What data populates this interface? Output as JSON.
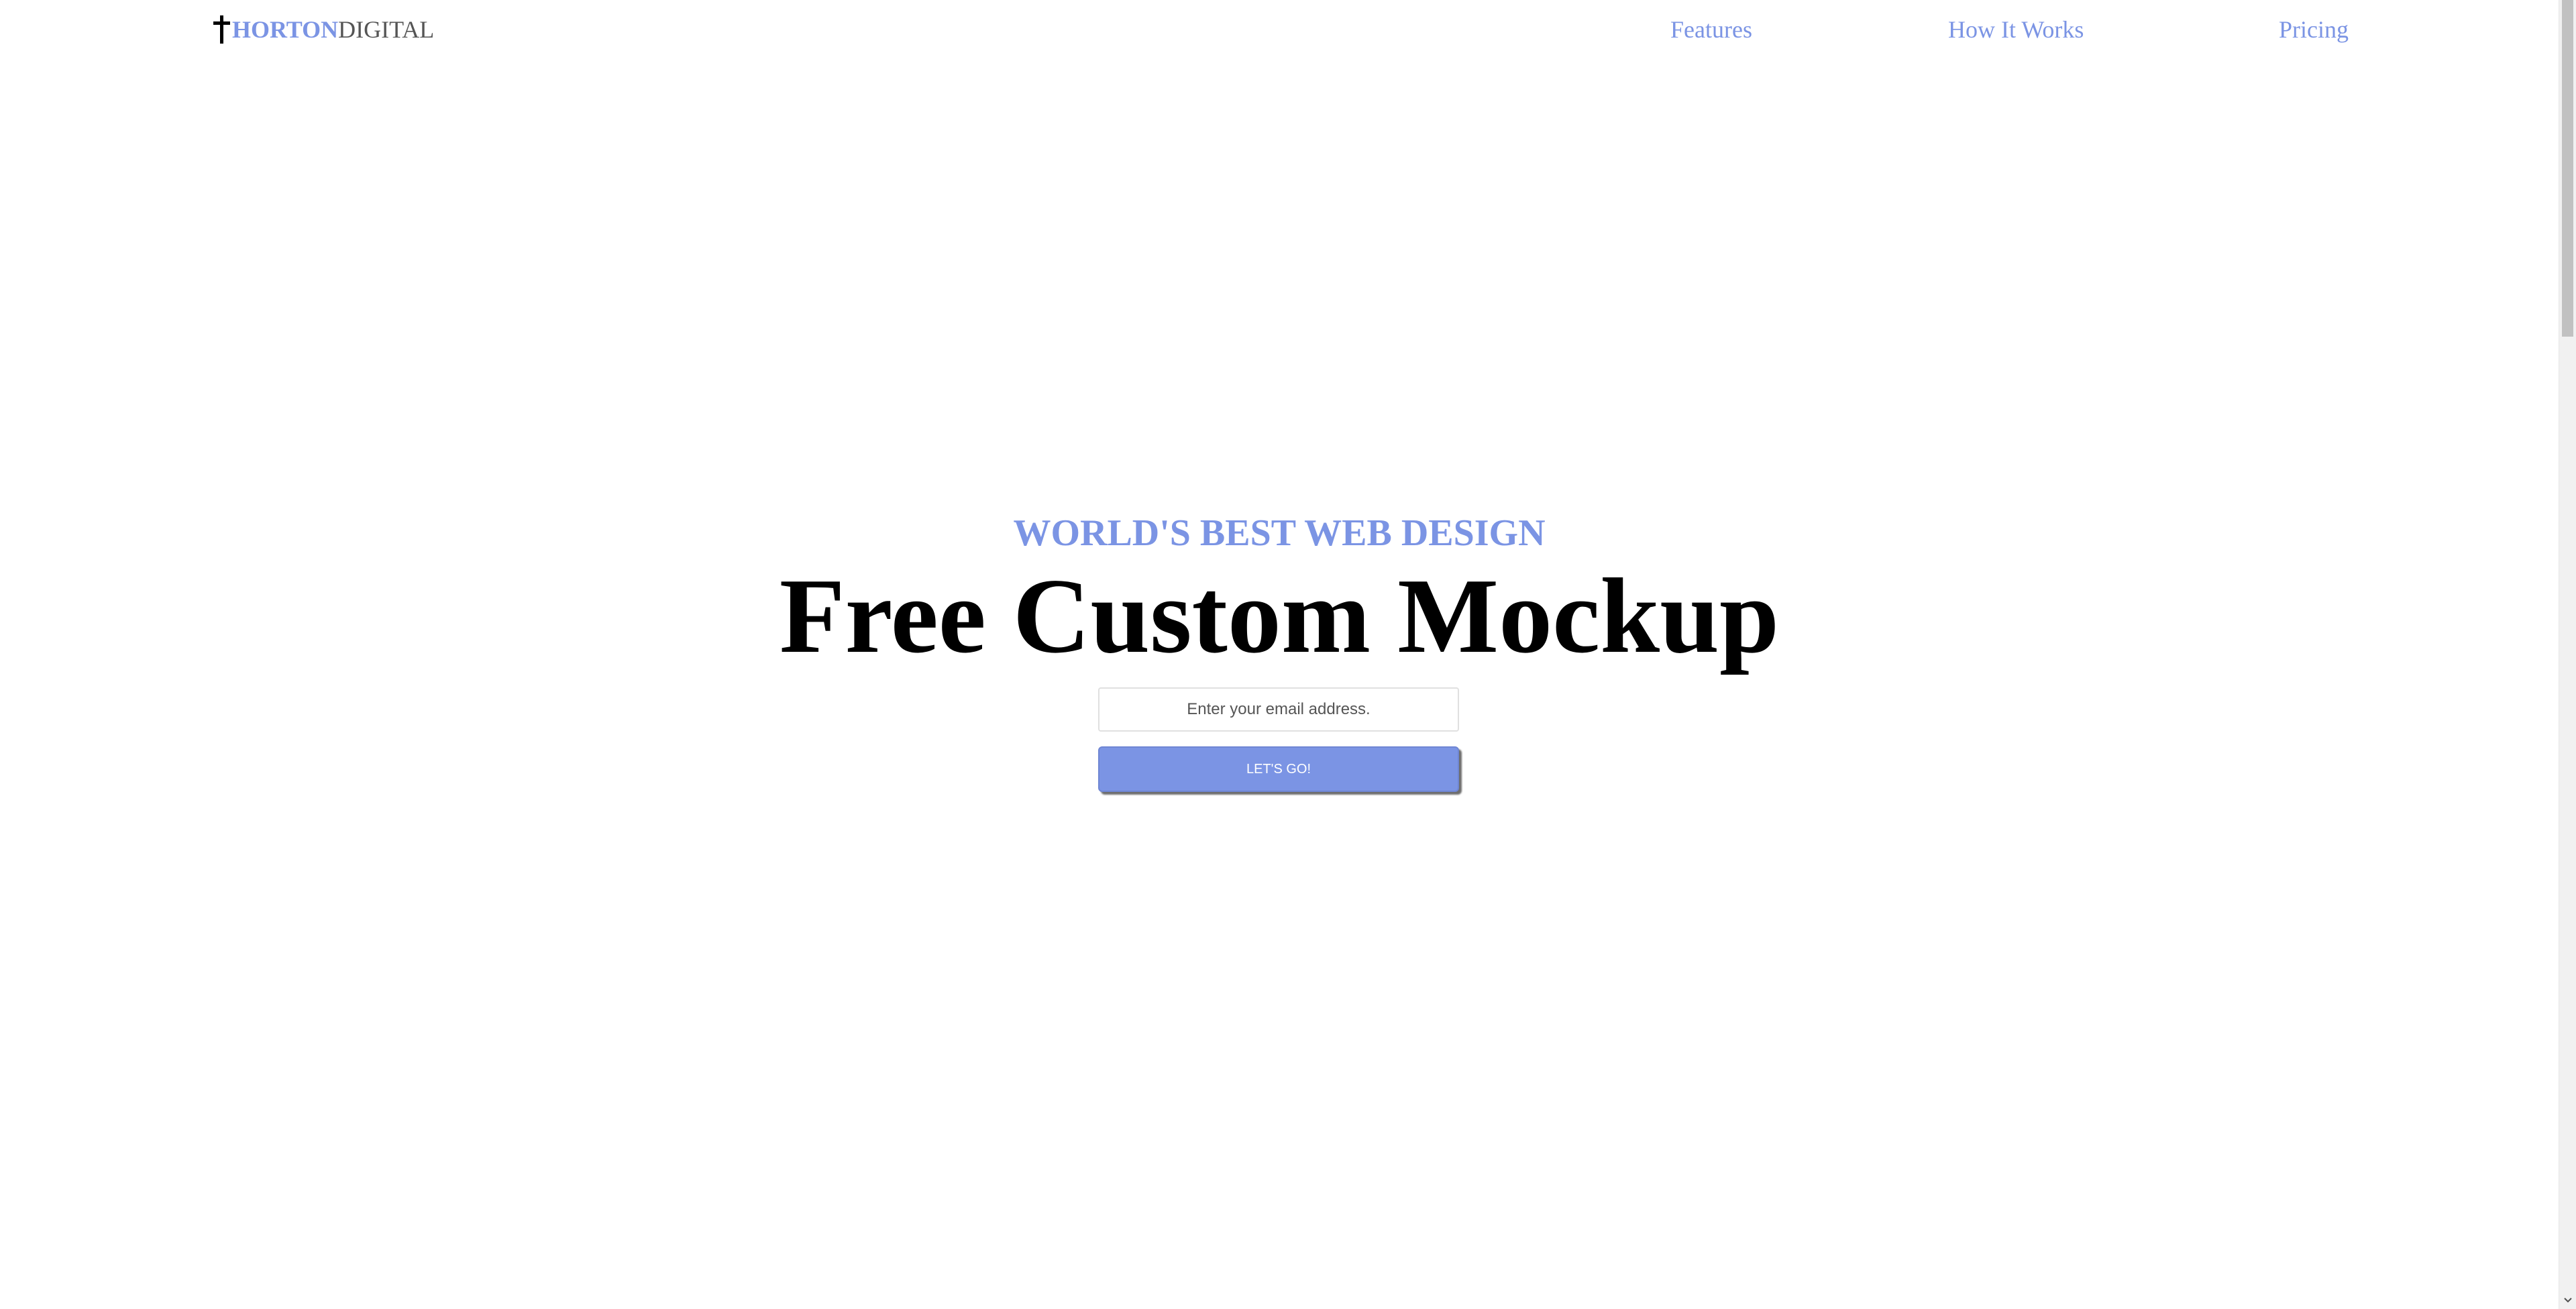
{
  "header": {
    "logo_icon": "cross-icon",
    "logo_bold": "HORTON",
    "logo_light": "DIGITAL",
    "nav": [
      {
        "label": "Features"
      },
      {
        "label": "How It Works"
      },
      {
        "label": "Pricing"
      }
    ]
  },
  "hero": {
    "eyebrow": "WORLD'S BEST WEB DESIGN",
    "headline": "Free Custom Mockup",
    "email_placeholder": "Enter your email address.",
    "email_value": "",
    "cta_label": "LET'S GO!"
  },
  "colors": {
    "accent": "#7b94e4",
    "text_dark": "#000000",
    "text_muted": "#555555",
    "background": "#ffffff"
  },
  "scrollbar": {
    "position": 0
  }
}
